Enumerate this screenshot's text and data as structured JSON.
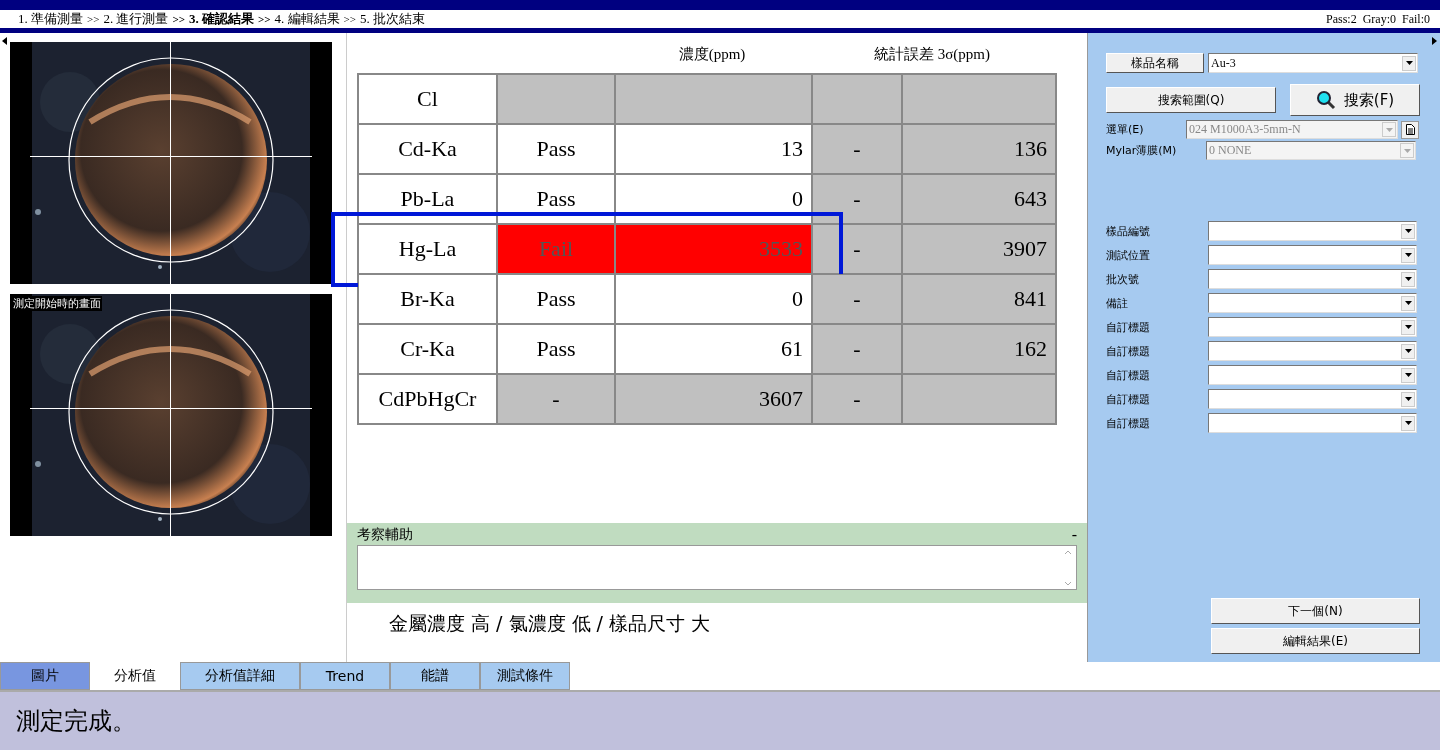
{
  "steps": [
    {
      "label": "1. 準備測量",
      "current": false
    },
    {
      "label": "2. 進行測量",
      "current": false
    },
    {
      "label": "3. 確認結果",
      "current": true
    },
    {
      "label": "4. 編輯結果",
      "current": false
    },
    {
      "label": "5. 批次結束",
      "current": false
    }
  ],
  "step_separator": ">>",
  "summary": "Pass:2  Gray:0  Fail:0",
  "images": [
    {
      "kind": "picture"
    },
    {
      "kind": "picture",
      "caption": "測定開始時的畫面"
    }
  ],
  "table": {
    "headers": [
      "濃度(ppm)",
      "統計誤差 3σ(ppm)"
    ],
    "rows": [
      {
        "element": "Cl",
        "pass": false,
        "fail": false,
        "judgement": "",
        "value": "",
        "dash": "",
        "sigma": "",
        "highlighted": false
      },
      {
        "element": "Cd-Ka",
        "pass": true,
        "fail": false,
        "judgement": "Pass",
        "value": "13",
        "dash": "-",
        "sigma": "136",
        "highlighted": false
      },
      {
        "element": "Pb-La",
        "pass": true,
        "fail": false,
        "judgement": "Pass",
        "value": "0",
        "dash": "-",
        "sigma": "643",
        "highlighted": false
      },
      {
        "element": "Hg-La",
        "pass": false,
        "fail": true,
        "judgement": "Fail",
        "value": "3533",
        "dash": "-",
        "sigma": "3907",
        "highlighted": true
      },
      {
        "element": "Br-Ka",
        "pass": true,
        "fail": false,
        "judgement": "Pass",
        "value": "0",
        "dash": "-",
        "sigma": "841",
        "highlighted": false
      },
      {
        "element": "Cr-Ka",
        "pass": true,
        "fail": false,
        "judgement": "Pass",
        "value": "61",
        "dash": "-",
        "sigma": "162",
        "highlighted": false
      },
      {
        "element": "CdPbHgCr",
        "pass": false,
        "fail": false,
        "judgement": "-",
        "value": "3607",
        "dash": "-",
        "sigma": "",
        "highlighted": false
      }
    ]
  },
  "remarks": {
    "title": "考察輔助",
    "collapse": "-"
  },
  "assessment": "金屬濃度 高 / 氯濃度 低 / 樣品尺寸 大",
  "tabs": [
    {
      "label": "圖片",
      "selected": false,
      "hovered": true
    },
    {
      "label": "分析值",
      "selected": true,
      "hovered": false
    },
    {
      "label": "分析值詳細",
      "selected": false,
      "hovered": false
    },
    {
      "label": "Trend",
      "selected": false,
      "hovered": false
    },
    {
      "label": "能譜",
      "selected": false,
      "hovered": false
    },
    {
      "label": "測試條件",
      "selected": false,
      "hovered": false
    }
  ],
  "status_bar": "測定完成。",
  "side": {
    "sample_name_button": "樣品名稱",
    "sample_name": "Au-3",
    "search_range_button": "搜索範圍(Q)",
    "search_button": "搜索(F)",
    "menu": {
      "label": "選單(E)",
      "value": "024 M1000A3-5mm-N",
      "disabled": true
    },
    "mylar": {
      "label": "Mylar薄膜(M)",
      "value": "0 NONE",
      "disabled": true
    },
    "fields": [
      {
        "label": "樣品編號"
      },
      {
        "label": "測試位置"
      },
      {
        "label": "批次號"
      },
      {
        "label": "備註"
      },
      {
        "label": "自訂標題"
      },
      {
        "label": "自訂標題"
      },
      {
        "label": "自訂標題"
      },
      {
        "label": "自訂標題"
      },
      {
        "label": "自訂標題"
      }
    ],
    "buttons": [
      "下一個(N)",
      "編輯結果(E)"
    ]
  }
}
